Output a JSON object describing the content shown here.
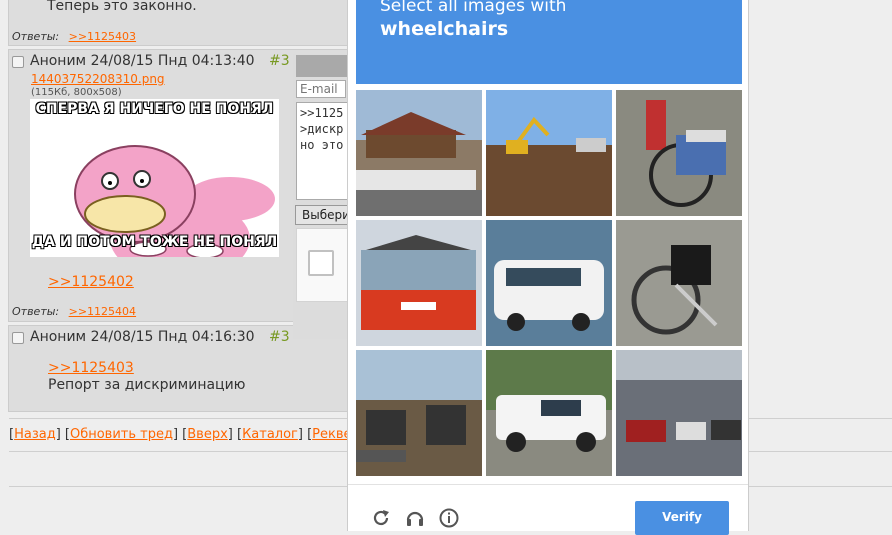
{
  "thread": {
    "post1": {
      "text": "Теперь это законно.",
      "replies_label": "Ответы:",
      "replies": ">>1125403"
    },
    "post2": {
      "author": "Аноним",
      "datetime": "24/08/15 Пнд 04:13:40",
      "num": "#3",
      "file_name": "14403752208310.png",
      "file_info": "(115Кб, 800x508)",
      "meme_top": "СПЕРВА Я НИЧЕГО НЕ ПОНЯЛ",
      "meme_bottom": "ДА И ПОТОМ ТОЖЕ НЕ ПОНЯЛ",
      "reflink": ">>1125402",
      "replies_label": "Ответы:",
      "replies": ">>1125404"
    },
    "post3": {
      "author": "Аноним",
      "datetime": "24/08/15 Пнд 04:16:30",
      "num": "#3",
      "num_tail": "№",
      "reflink": ">>1125403",
      "text": "Репорт за дискриминацию"
    }
  },
  "form": {
    "email_placeholder": "E-mail",
    "message": ">>1125\n>дискр\nно это",
    "choose_button": "Выбери"
  },
  "nav": {
    "back": "Назад",
    "refresh": "Обновить тред",
    "top": "Вверх",
    "catalog": "Каталог",
    "requisites": "Реквес"
  },
  "captcha": {
    "instruction": "Select all images with",
    "target": "wheelchairs",
    "verify_label": "Verify",
    "icons": [
      "reload-icon",
      "audio-icon",
      "info-icon"
    ],
    "tiles": [
      {
        "name": "tile-boat-building"
      },
      {
        "name": "tile-excavator-field"
      },
      {
        "name": "tile-wheelchair-red-stand"
      },
      {
        "name": "tile-red-truck"
      },
      {
        "name": "tile-white-van"
      },
      {
        "name": "tile-black-wheelchair"
      },
      {
        "name": "tile-skid-steer"
      },
      {
        "name": "tile-white-pickup"
      },
      {
        "name": "tile-garage-cars"
      }
    ],
    "accent": "#4a90e2"
  },
  "colors": {
    "link": "#ff6600",
    "post_num": "#789922",
    "post_bg": "#dddddd"
  }
}
